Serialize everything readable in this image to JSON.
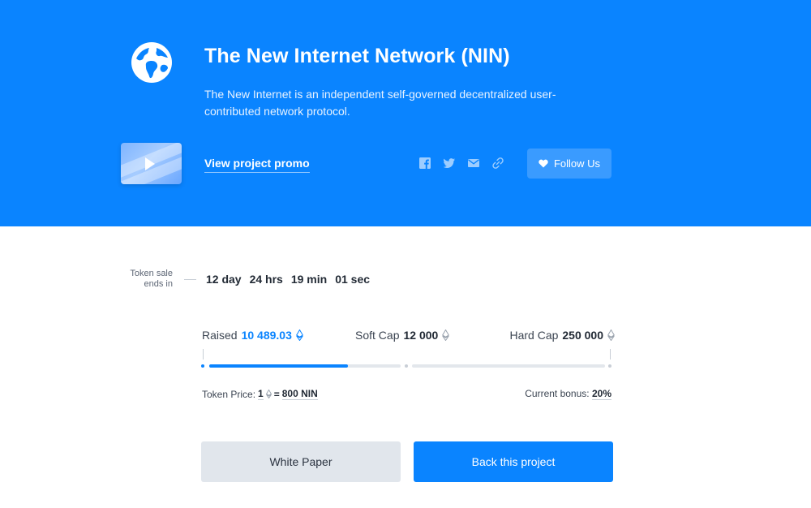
{
  "hero": {
    "title": "The New Internet Network (NIN)",
    "description": "The New Internet is an independent self-governed decentralized user-contributed network protocol.",
    "promo_link": "View project promo",
    "follow_label": "Follow Us",
    "socials": [
      "facebook-icon",
      "twitter-icon",
      "mail-icon",
      "link-icon"
    ],
    "background_color": "#0a84ff"
  },
  "sale": {
    "label_line1": "Token sale",
    "label_line2": "ends in",
    "countdown": [
      "12 day",
      "24 hrs",
      "19 min",
      "01 sec"
    ]
  },
  "stats": {
    "raised_label": "Raised",
    "raised_value": "10 489.03",
    "softcap_label": "Soft Cap",
    "softcap_value": "12 000",
    "hardcap_label": "Hard Cap",
    "hardcap_value": "250 000",
    "progress_fraction": 0.35
  },
  "token": {
    "price_label": "Token Price:",
    "price_amount": "1",
    "price_value": "800 NIN",
    "bonus_label": "Current bonus:",
    "bonus_value": "20%"
  },
  "buttons": {
    "white_paper": "White Paper",
    "back_project": "Back this project"
  }
}
